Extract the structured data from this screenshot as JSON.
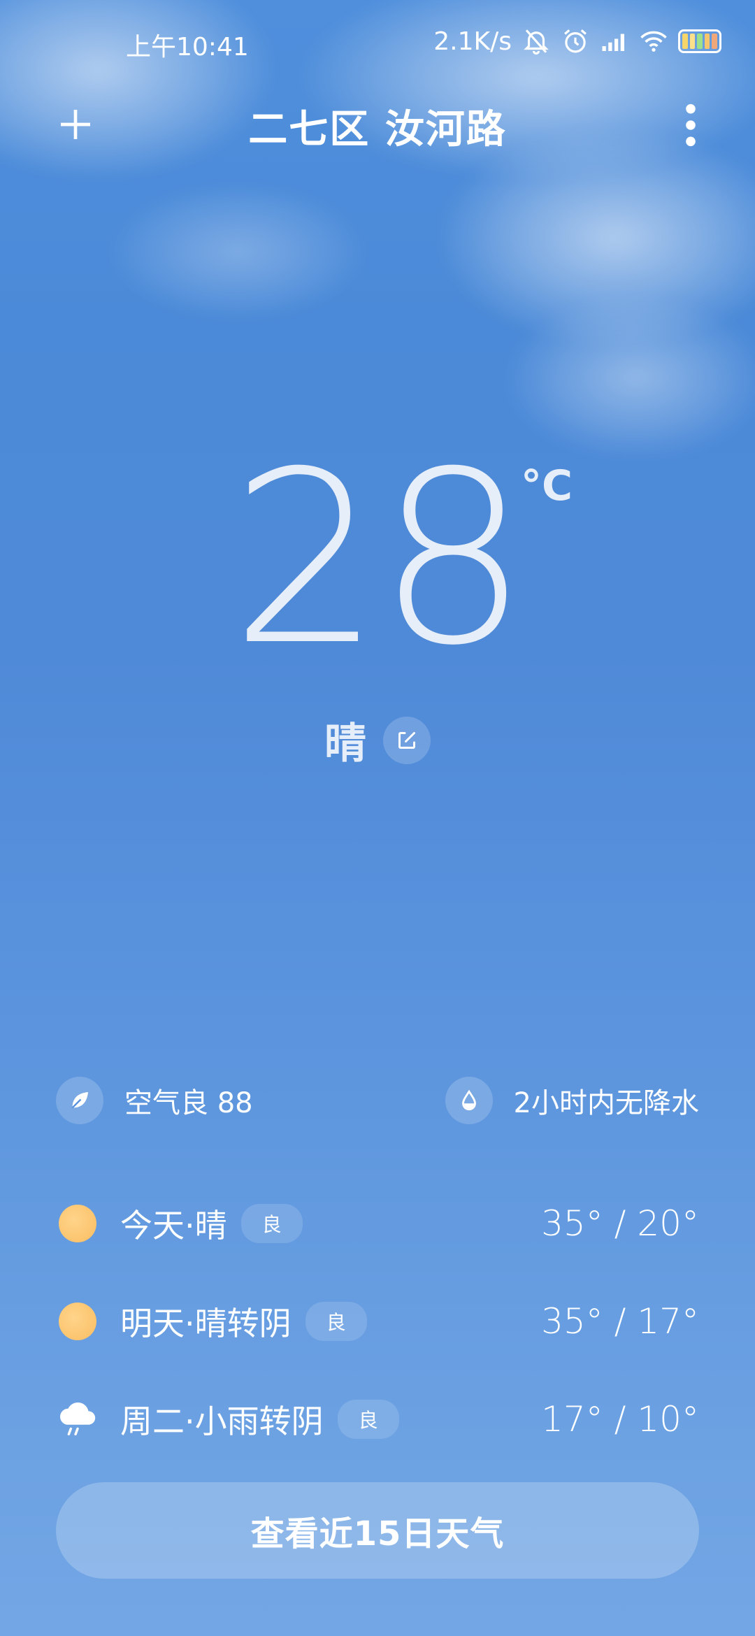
{
  "status_bar": {
    "time": "上午10:41",
    "network_speed": "2.1K/s",
    "icons": [
      "mute-icon",
      "alarm-icon",
      "signal-icon",
      "wifi-icon",
      "battery-icon"
    ],
    "battery_colors": [
      "#f6d56b",
      "#ffe08a",
      "#9fe08a",
      "#f7c66c",
      "#f0a77a"
    ]
  },
  "header": {
    "add_icon": "plus-icon",
    "location": "二七区 汝河路",
    "more_icon": "more-vertical-icon"
  },
  "current": {
    "temperature": "28",
    "unit": "°C",
    "condition": "晴",
    "edit_icon": "edit-icon"
  },
  "info": {
    "air_icon": "leaf-icon",
    "air_quality": "空气良 88",
    "rain_icon": "drop-icon",
    "precipitation": "2小时内无降水"
  },
  "forecast": [
    {
      "icon": "sun-icon",
      "label": "今天·晴",
      "aqi": "良",
      "temps": "35° / 20°"
    },
    {
      "icon": "sun-icon",
      "label": "明天·晴转阴",
      "aqi": "良",
      "temps": "35° / 17°"
    },
    {
      "icon": "rain-cloud-icon",
      "label": "周二·小雨转阴",
      "aqi": "良",
      "temps": "17° / 10°"
    }
  ],
  "fifteen_day_button": "查看近15日天气",
  "colors": {
    "sky_top": "#4f8fdc",
    "sky_bottom": "#73a6e4",
    "sun": "#fbc46e"
  }
}
